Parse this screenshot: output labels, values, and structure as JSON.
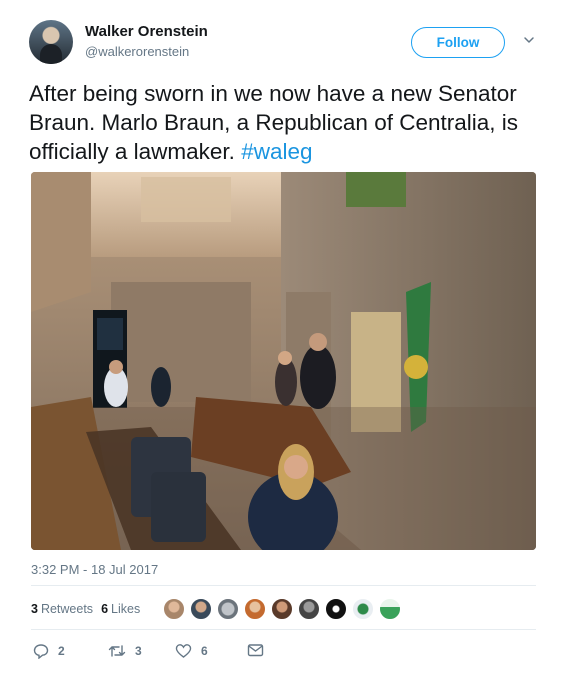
{
  "tweet": {
    "author_name": "Walker Orenstein",
    "author_handle": "@walkerorenstein",
    "follow_label": "Follow",
    "text": "After being sworn in we now have a new Senator Braun. Marlo Braun, a Republican of Centralia, is officially a lawmaker.",
    "hashtag": "#waleg",
    "timestamp": "3:32 PM - 18 Jul 2017"
  },
  "stats": {
    "retweets_count": "3",
    "retweets_label": "Retweets",
    "likes_count": "6",
    "likes_label": "Likes"
  },
  "actions": {
    "reply_count": "2",
    "retweet_count": "3",
    "like_count": "6"
  },
  "icons": [
    "chevron-down-icon",
    "reply-icon",
    "retweet-icon",
    "heart-icon",
    "envelope-icon"
  ],
  "colors": {
    "accent": "#1da1f2",
    "hashtag": "#1b95e0",
    "secondary_text": "#657786"
  }
}
